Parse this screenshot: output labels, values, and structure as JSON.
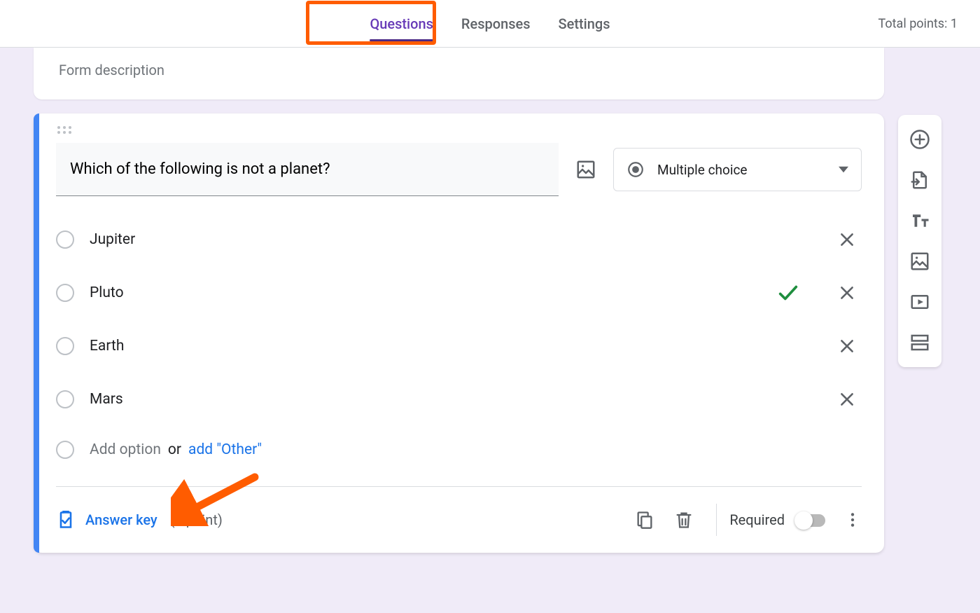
{
  "header": {
    "tabs": [
      "Questions",
      "Responses",
      "Settings"
    ],
    "active_tab_index": 0,
    "total_points_label": "Total points: 1"
  },
  "form": {
    "description_placeholder": "Form description"
  },
  "question": {
    "text": "Which of the following is not a planet?",
    "type_label": "Multiple choice",
    "options": [
      {
        "label": "Jupiter",
        "correct": false
      },
      {
        "label": "Pluto",
        "correct": true
      },
      {
        "label": "Earth",
        "correct": false
      },
      {
        "label": "Mars",
        "correct": false
      }
    ],
    "add_option_label": "Add option",
    "or_label": "or",
    "add_other_label": "add \"Other\"",
    "answer_key_label": "Answer key",
    "points_label": "(1 point)",
    "required_label": "Required",
    "required": false
  },
  "toolbar": {
    "items": [
      "add-question",
      "import-questions",
      "add-title",
      "add-image",
      "add-video",
      "add-section"
    ]
  },
  "annotations": {
    "highlight_tab": true,
    "arrow_to_answer_key": true
  }
}
